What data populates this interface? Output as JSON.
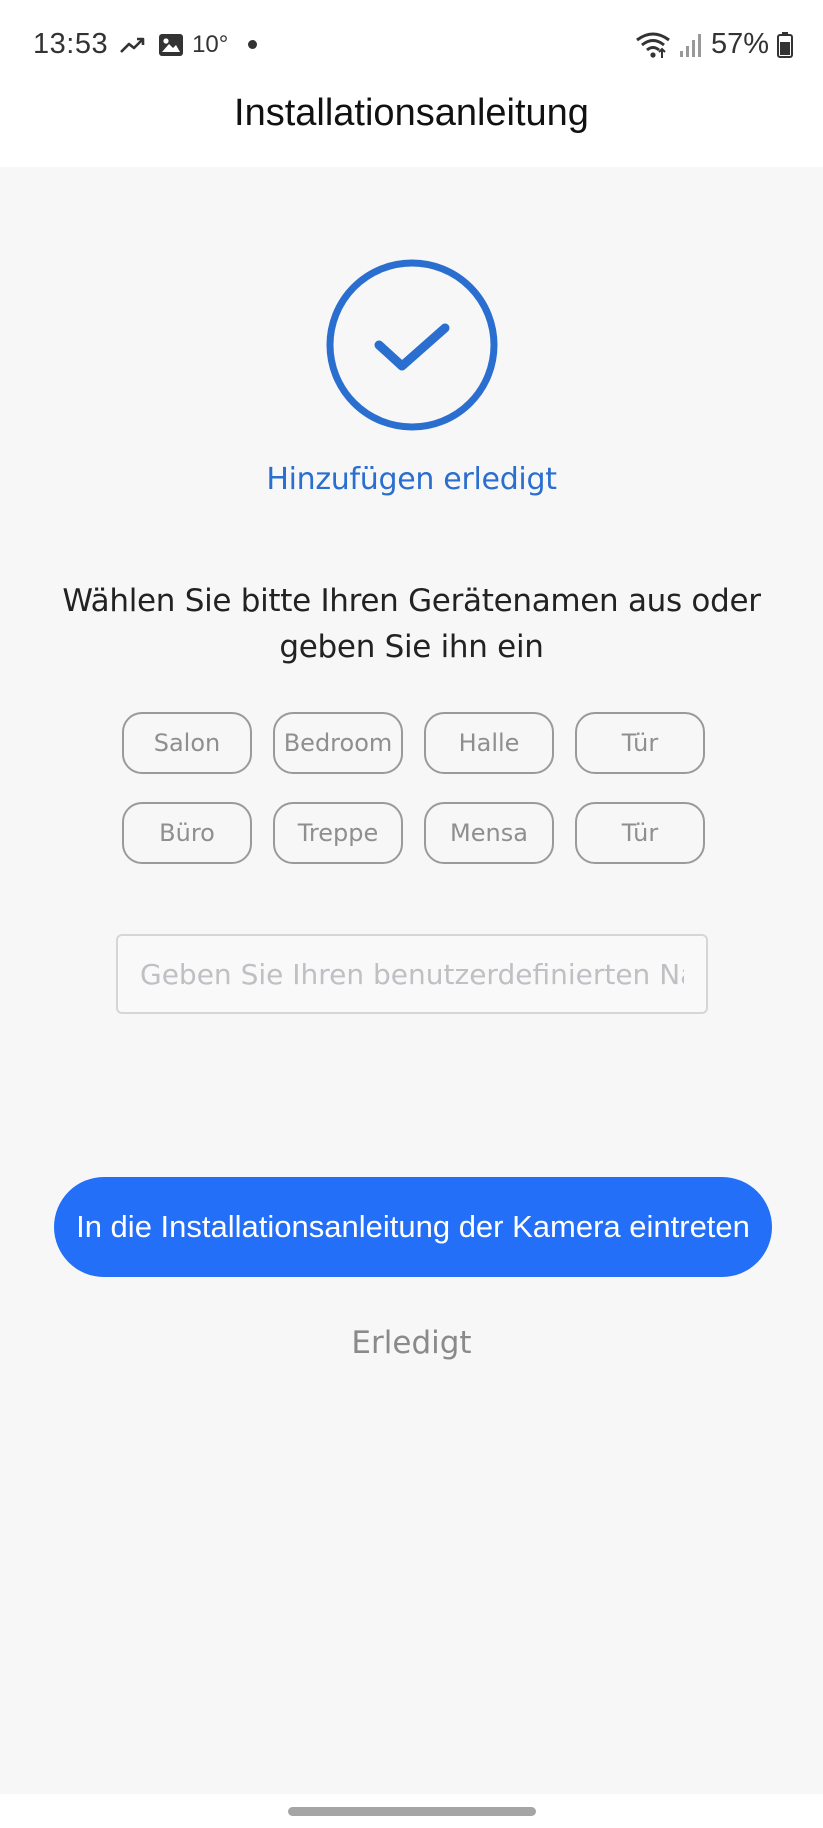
{
  "status_bar": {
    "time": "13:53",
    "temperature": "10°",
    "battery": "57%",
    "icons": [
      "trending-icon",
      "image-icon",
      "wifi-icon",
      "signal-icon",
      "battery-icon"
    ]
  },
  "header": {
    "title": "Installationsanleitung"
  },
  "success": {
    "icon": "checkmark-circle-icon",
    "text": "Hinzufügen erledigt"
  },
  "prompt": {
    "text": "Wählen Sie bitte Ihren Gerätenamen aus oder geben Sie ihn ein"
  },
  "chips": [
    "Salon",
    "Bedroom",
    "Halle",
    "Tür",
    "Büro",
    "Treppe",
    "Mensa",
    "Tür"
  ],
  "custom_name": {
    "placeholder": "Geben Sie Ihren benutzerdefinierten Namen ein",
    "value": ""
  },
  "actions": {
    "primary_label": "In die Installationsanleitung der Kamera eintreten",
    "done_label": "Erledigt"
  },
  "colors": {
    "accent": "#236ff7",
    "success": "#2a6fcf",
    "background": "#f7f7f8"
  }
}
